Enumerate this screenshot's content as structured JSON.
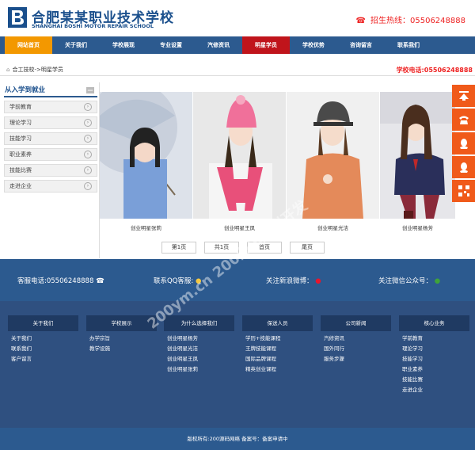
{
  "header": {
    "logo_cn": "合肥某某职业技术学校",
    "logo_en": "SHANGHAI BOSHI MOTOR REPAIR SCHOOL",
    "hotline": "招生热线：05506248888"
  },
  "nav": [
    "网站首页",
    "关于我们",
    "学校展现",
    "专业设置",
    "汽修资讯",
    "明星学员",
    "学校优势",
    "咨询留言",
    "联系我们"
  ],
  "breadcrumb": "合工技校->明星学员",
  "school_tel": "学校电话:05506248888",
  "sidebar": {
    "title": "从入学到就业",
    "items": [
      "学前教育",
      "理论学习",
      "技能学习",
      "职业素养",
      "技能比赛",
      "走进企业"
    ]
  },
  "photos": [
    {
      "caption": "创业明星张莉"
    },
    {
      "caption": "创业明星王凤"
    },
    {
      "caption": "创业明星光洁"
    },
    {
      "caption": "创业明星杨芳"
    }
  ],
  "pager": [
    "第1页",
    "共1页",
    "首页",
    "尾页"
  ],
  "contact": {
    "phone": "客服电话:05506248888",
    "qq": "联系QQ客服:",
    "weibo": "关注新浪微博：",
    "wechat": "关注微信公众号："
  },
  "footer_cols": [
    {
      "head": "关于我们",
      "links": [
        "关于我们",
        "联系我们",
        "客户留言"
      ]
    },
    {
      "head": "学校展示",
      "links": [
        "办学宗旨",
        "教学设施"
      ]
    },
    {
      "head": "为什么选择我们",
      "links": [
        "创业明星杨芳",
        "创业明星光洁",
        "创业明星王凤",
        "创业明星张莉"
      ]
    },
    {
      "head": "保送人员",
      "links": [
        "学历+技能课程",
        "王牌技能课程",
        "国际品牌课程",
        "精英创业课程"
      ]
    },
    {
      "head": "公司新闻",
      "links": [
        "汽修资讯",
        "国外同行",
        "服务步骤"
      ]
    },
    {
      "head": "核心业务",
      "links": [
        "学前教育",
        "理论学习",
        "技能学习",
        "职业素养",
        "技能比赛",
        "走进企业"
      ]
    }
  ],
  "copyright": "版权所有:200源码网络  备案号：备案申请中",
  "watermark": "200ym.cn 200源码原创开发",
  "colors": {
    "nav": "#2c5a8f",
    "home": "#f39800",
    "active": "#c0141b",
    "float": "#f05a1a"
  }
}
